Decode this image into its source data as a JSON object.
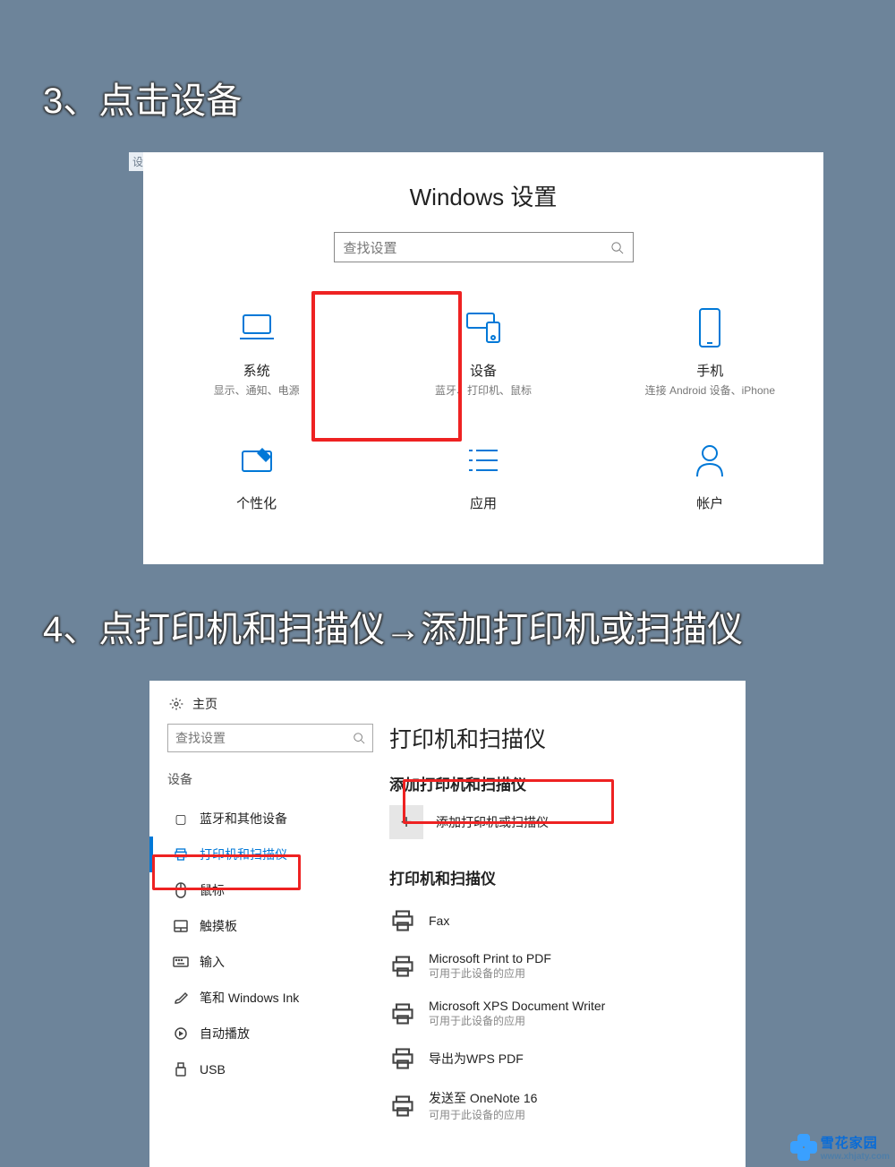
{
  "steps": {
    "s3": "3、点击设备",
    "s4": "4、点打印机和扫描仪→添加打印机或扫描仪"
  },
  "top_tag": "设置",
  "panel1": {
    "title": "Windows 设置",
    "search_placeholder": "查找设置",
    "cats": [
      {
        "title": "系统",
        "desc": "显示、通知、电源"
      },
      {
        "title": "设备",
        "desc": "蓝牙、打印机、鼠标"
      },
      {
        "title": "手机",
        "desc": "连接 Android 设备、iPhone"
      }
    ],
    "cats2": [
      {
        "title": "个性化"
      },
      {
        "title": "应用"
      },
      {
        "title": "帐户"
      }
    ]
  },
  "panel2": {
    "home": "主页",
    "search_placeholder": "查找设置",
    "side_cat": "设备",
    "side_items": [
      {
        "label": "蓝牙和其他设备"
      },
      {
        "label": "打印机和扫描仪",
        "active": true
      },
      {
        "label": "鼠标"
      },
      {
        "label": "触摸板"
      },
      {
        "label": "输入"
      },
      {
        "label": "笔和 Windows Ink"
      },
      {
        "label": "自动播放"
      },
      {
        "label": "USB"
      }
    ],
    "main": {
      "h1": "打印机和扫描仪",
      "add_section": "添加打印机和扫描仪",
      "add_button": "添加打印机或扫描仪",
      "list_heading": "打印机和扫描仪",
      "printers": [
        {
          "name": "Fax"
        },
        {
          "name": "Microsoft Print to PDF",
          "sub": "可用于此设备的应用"
        },
        {
          "name": "Microsoft XPS Document Writer",
          "sub": "可用于此设备的应用"
        },
        {
          "name": "导出为WPS PDF"
        },
        {
          "name": "发送至 OneNote 16",
          "sub": "可用于此设备的应用"
        }
      ]
    }
  },
  "watermark": {
    "brand": "雪花家园",
    "url": "www.xhjaty.com"
  }
}
